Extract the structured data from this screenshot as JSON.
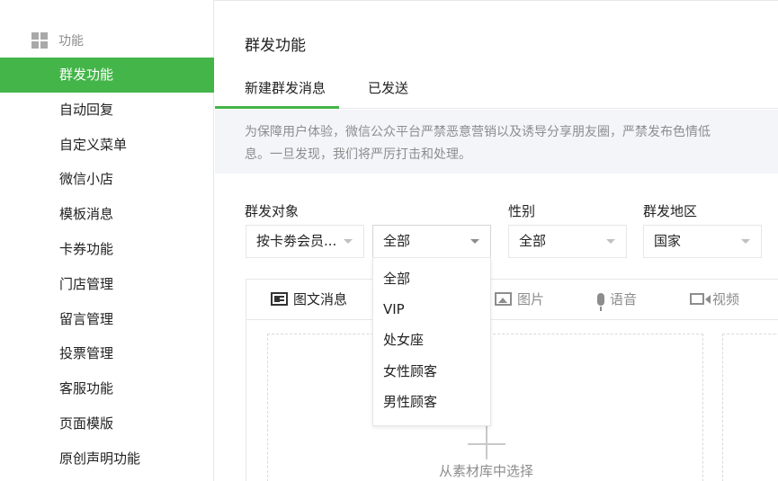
{
  "sidebar": {
    "section_label": "功能",
    "section_icon": "grid-icon",
    "items": [
      {
        "label": "群发功能",
        "active": true
      },
      {
        "label": "自动回复"
      },
      {
        "label": "自定义菜单"
      },
      {
        "label": "微信小店"
      },
      {
        "label": "模板消息"
      },
      {
        "label": "卡券功能"
      },
      {
        "label": "门店管理"
      },
      {
        "label": "留言管理"
      },
      {
        "label": "投票管理"
      },
      {
        "label": "客服功能"
      },
      {
        "label": "页面模版"
      },
      {
        "label": "原创声明功能"
      }
    ]
  },
  "main": {
    "title": "群发功能",
    "tabs": [
      {
        "label": "新建群发消息",
        "active": true
      },
      {
        "label": "已发送"
      }
    ],
    "notice_line1": "为保障用户体验，微信公众平台严禁恶意营销以及诱导分享朋友圈，严禁发布色情低",
    "notice_line2": "息。一旦发现，我们将严厉打击和处理。"
  },
  "filters": {
    "target_label": "群发对象",
    "target_value": "按卡劵会员...",
    "group_value": "全部",
    "gender_label": "性别",
    "gender_value": "全部",
    "region_label": "群发地区",
    "region_value": "国家"
  },
  "dropdown": {
    "options": [
      "全部",
      "VIP",
      "处女座",
      "女性顾客",
      "男性顾客"
    ]
  },
  "editor": {
    "tabs": [
      {
        "label": "图文消息",
        "icon": "news-icon"
      },
      {
        "label": "图片",
        "icon": "image-icon"
      },
      {
        "label": "语音",
        "icon": "voice-icon"
      },
      {
        "label": "视频",
        "icon": "video-icon"
      }
    ],
    "drop_label": "从素材库中选择",
    "drop_icon": "plus-icon"
  },
  "colors": {
    "accent": "#44b549",
    "notice_bg": "#f4f5f9",
    "muted_text": "#8d8d8d",
    "border": "#e7e7eb"
  }
}
